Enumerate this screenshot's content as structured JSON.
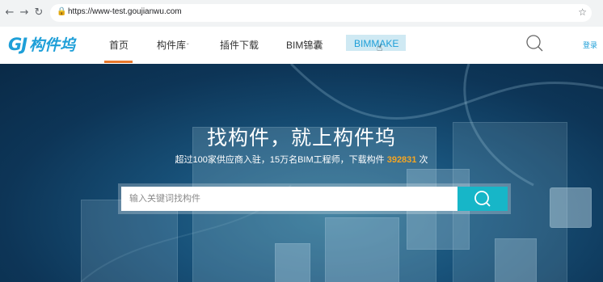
{
  "browser": {
    "url": "https://www-test.goujianwu.com"
  },
  "header": {
    "logo_mark": "GJ",
    "logo_text": "构件坞",
    "nav": [
      "首页",
      "构件库",
      "插件下载",
      "BIM锦囊",
      "BIMMAKE"
    ],
    "login": "登录"
  },
  "hero": {
    "title": "找构件，就上构件坞",
    "sub_prefix": "超过100家供应商入驻，15万名BIM工程师，下载构件 ",
    "count": "392831",
    "sub_suffix": " 次",
    "search_placeholder": "输入关键词找构件"
  },
  "colors": {
    "accent": "#1e9fd8",
    "active_underline": "#e8782c",
    "search_button": "#17b6c8",
    "count": "#f5a623"
  }
}
